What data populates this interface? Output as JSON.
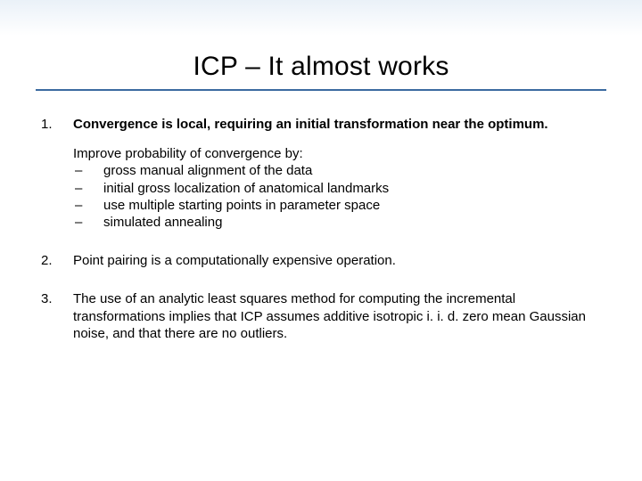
{
  "title": "ICP – It almost works",
  "items": [
    {
      "num": "1.",
      "lead": "Convergence is local, requiring an initial transformation near the optimum.",
      "sub_intro": "Improve probability of convergence by:",
      "bullets": [
        " gross manual alignment of the data",
        "initial gross localization of anatomical landmarks",
        "use multiple starting points in parameter space",
        "simulated annealing"
      ]
    },
    {
      "num": "2.",
      "text": "Point pairing is a computationally expensive operation."
    },
    {
      "num": "3.",
      "text": "The use of an analytic least squares method for computing the incremental transformations implies that ICP  assumes additive isotropic i. i. d. zero mean Gaussian noise, and that there are no outliers."
    }
  ]
}
